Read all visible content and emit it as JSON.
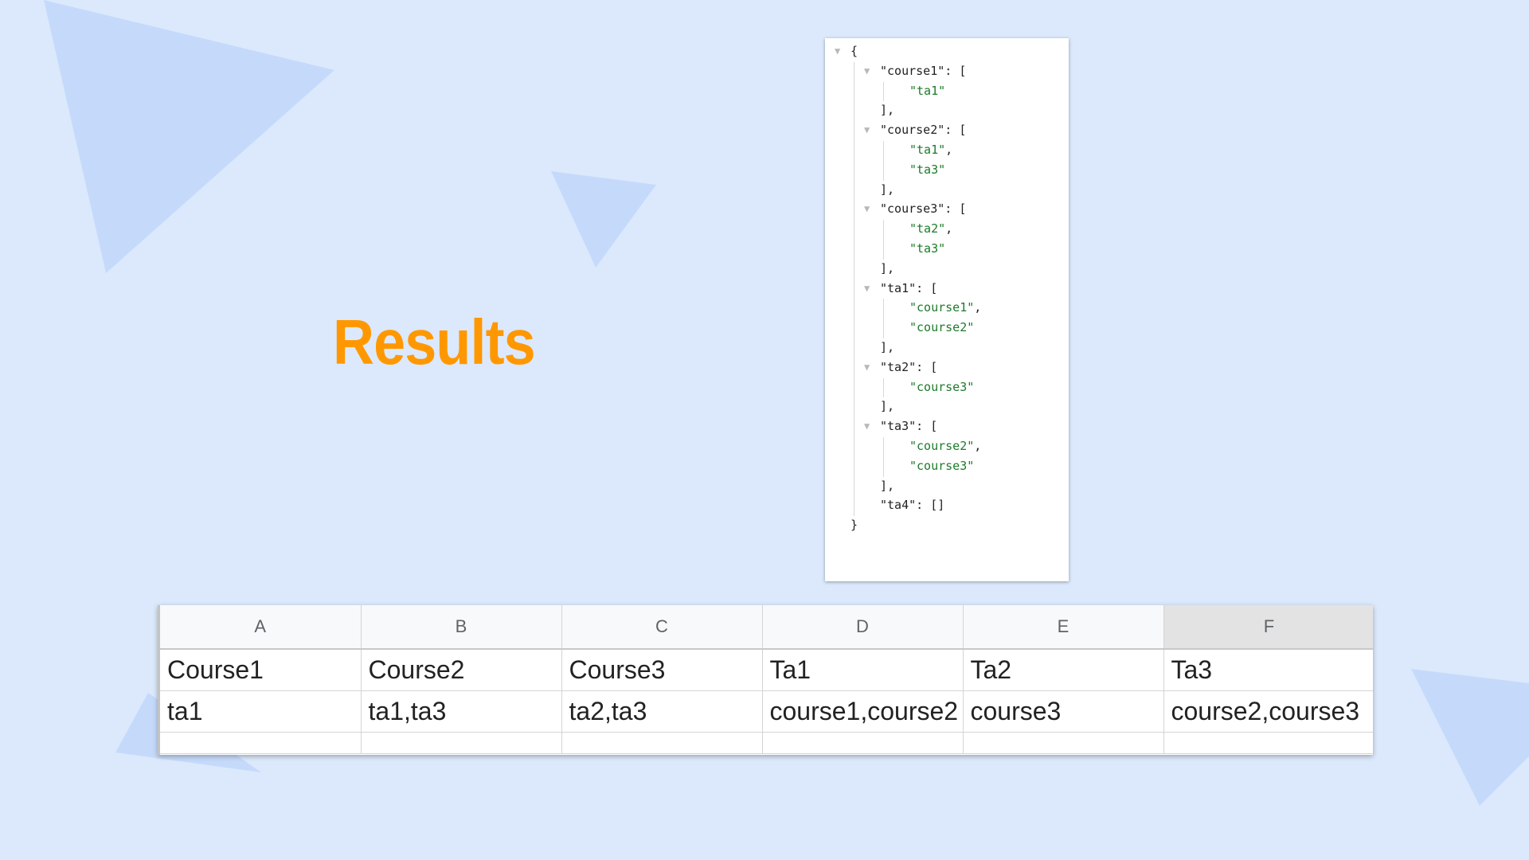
{
  "slide": {
    "title": "Results",
    "title_color": "#ff9800",
    "background_color": "#dce9fc"
  },
  "json_viewer": {
    "lines": [
      {
        "indent": 0,
        "collapsible": true,
        "key": "",
        "punct": "{",
        "str": "",
        "trail": ""
      },
      {
        "indent": 1,
        "collapsible": true,
        "key": "\"course1\"",
        "punct": ": [",
        "str": "",
        "trail": ""
      },
      {
        "indent": 2,
        "collapsible": false,
        "key": "",
        "punct": "",
        "str": "\"ta1\"",
        "trail": ""
      },
      {
        "indent": 1,
        "collapsible": false,
        "key": "",
        "punct": "],",
        "str": "",
        "trail": ""
      },
      {
        "indent": 1,
        "collapsible": true,
        "key": "\"course2\"",
        "punct": ": [",
        "str": "",
        "trail": ""
      },
      {
        "indent": 2,
        "collapsible": false,
        "key": "",
        "punct": "",
        "str": "\"ta1\"",
        "trail": ","
      },
      {
        "indent": 2,
        "collapsible": false,
        "key": "",
        "punct": "",
        "str": "\"ta3\"",
        "trail": ""
      },
      {
        "indent": 1,
        "collapsible": false,
        "key": "",
        "punct": "],",
        "str": "",
        "trail": ""
      },
      {
        "indent": 1,
        "collapsible": true,
        "key": "\"course3\"",
        "punct": ": [",
        "str": "",
        "trail": ""
      },
      {
        "indent": 2,
        "collapsible": false,
        "key": "",
        "punct": "",
        "str": "\"ta2\"",
        "trail": ","
      },
      {
        "indent": 2,
        "collapsible": false,
        "key": "",
        "punct": "",
        "str": "\"ta3\"",
        "trail": ""
      },
      {
        "indent": 1,
        "collapsible": false,
        "key": "",
        "punct": "],",
        "str": "",
        "trail": ""
      },
      {
        "indent": 1,
        "collapsible": true,
        "key": "\"ta1\"",
        "punct": ": [",
        "str": "",
        "trail": ""
      },
      {
        "indent": 2,
        "collapsible": false,
        "key": "",
        "punct": "",
        "str": "\"course1\"",
        "trail": ","
      },
      {
        "indent": 2,
        "collapsible": false,
        "key": "",
        "punct": "",
        "str": "\"course2\"",
        "trail": ""
      },
      {
        "indent": 1,
        "collapsible": false,
        "key": "",
        "punct": "],",
        "str": "",
        "trail": ""
      },
      {
        "indent": 1,
        "collapsible": true,
        "key": "\"ta2\"",
        "punct": ": [",
        "str": "",
        "trail": ""
      },
      {
        "indent": 2,
        "collapsible": false,
        "key": "",
        "punct": "",
        "str": "\"course3\"",
        "trail": ""
      },
      {
        "indent": 1,
        "collapsible": false,
        "key": "",
        "punct": "],",
        "str": "",
        "trail": ""
      },
      {
        "indent": 1,
        "collapsible": true,
        "key": "\"ta3\"",
        "punct": ": [",
        "str": "",
        "trail": ""
      },
      {
        "indent": 2,
        "collapsible": false,
        "key": "",
        "punct": "",
        "str": "\"course2\"",
        "trail": ","
      },
      {
        "indent": 2,
        "collapsible": false,
        "key": "",
        "punct": "",
        "str": "\"course3\"",
        "trail": ""
      },
      {
        "indent": 1,
        "collapsible": false,
        "key": "",
        "punct": "],",
        "str": "",
        "trail": ""
      },
      {
        "indent": 1,
        "collapsible": false,
        "key": "\"ta4\"",
        "punct": ": []",
        "str": "",
        "trail": ""
      },
      {
        "indent": 0,
        "collapsible": false,
        "key": "",
        "punct": "}",
        "str": "",
        "trail": ""
      }
    ],
    "string_color": "#1d7a2a",
    "toggle_icon": "triangle-down-icon"
  },
  "spreadsheet": {
    "columns": [
      "A",
      "B",
      "C",
      "D",
      "E",
      "F"
    ],
    "selected_column": "F",
    "rows": [
      [
        "Course1",
        "Course2",
        "Course3",
        "Ta1",
        "Ta2",
        "Ta3"
      ],
      [
        "ta1",
        "ta1,ta3",
        "ta2,ta3",
        "course1,course2",
        "course3",
        "course2,course3"
      ],
      [
        "",
        "",
        "",
        "",
        "",
        ""
      ]
    ]
  }
}
